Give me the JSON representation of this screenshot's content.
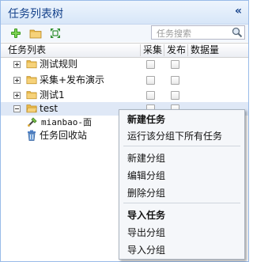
{
  "panel": {
    "title": "任务列表树",
    "collapse_glyph": "«"
  },
  "toolbar": {
    "add_icon": "add-icon",
    "folder_icon": "folder-icon",
    "expand_icon": "expand-all-icon",
    "search": {
      "placeholder": "任务搜索",
      "icon": "search-icon"
    }
  },
  "columns": [
    "任务列表",
    "采集",
    "发布",
    "数据量"
  ],
  "tree": [
    {
      "label": "测试规则",
      "type": "folder"
    },
    {
      "label": "采集+发布演示",
      "type": "folder"
    },
    {
      "label": "测试1",
      "type": "folder"
    },
    {
      "label": "test",
      "type": "folder",
      "selected": true
    },
    {
      "label": "mianbao-面",
      "type": "task"
    },
    {
      "label": "任务回收站",
      "type": "trash"
    }
  ],
  "context_menu": {
    "items": [
      {
        "label": "新建任务",
        "bold": true
      },
      {
        "label": "运行该分组下所有任务",
        "bold": false
      },
      {
        "label": "新建分组",
        "bold": false
      },
      {
        "label": "编辑分组",
        "bold": false
      },
      {
        "label": "删除分组",
        "bold": false
      },
      {
        "label": "导入任务",
        "bold": true
      },
      {
        "label": "导出分组",
        "bold": false
      },
      {
        "label": "导入分组",
        "bold": false
      }
    ]
  },
  "colors": {
    "accent": "#15428b",
    "border": "#99bbe8",
    "selection": "#dfe8f6"
  }
}
